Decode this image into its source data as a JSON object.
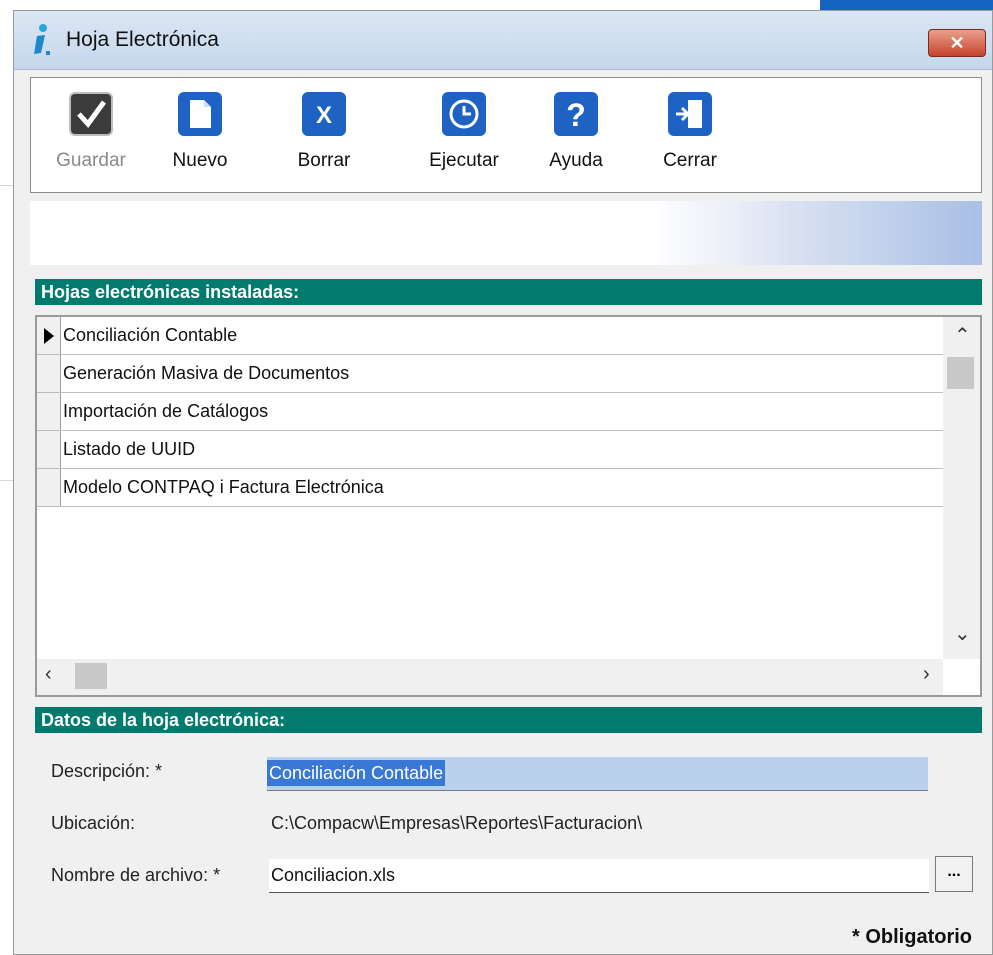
{
  "window": {
    "title": "Hoja Electrónica",
    "close_label": "✕"
  },
  "toolbar": [
    {
      "label": "Guardar",
      "icon": "checkmark-icon",
      "disabled": true
    },
    {
      "label": "Nuevo",
      "icon": "new-document-icon",
      "disabled": false
    },
    {
      "label": "Borrar",
      "icon": "delete-x-icon",
      "disabled": false
    },
    {
      "label": "Ejecutar",
      "icon": "clock-run-icon",
      "disabled": false
    },
    {
      "label": "Ayuda",
      "icon": "help-question-icon",
      "disabled": false
    },
    {
      "label": "Cerrar",
      "icon": "exit-door-icon",
      "disabled": false
    }
  ],
  "installed": {
    "header": "Hojas electrónicas instaladas:",
    "rows": [
      "Conciliación Contable",
      "Generación Masiva de Documentos",
      "Importación de Catálogos",
      "Listado de UUID",
      "Modelo CONTPAQ i Factura Electrónica"
    ],
    "selected_index": 0
  },
  "details": {
    "header": "Datos de la hoja electrónica:",
    "descripcion_label": "Descripción: *",
    "descripcion_value": "Conciliación Contable",
    "ubicacion_label": "Ubicación:",
    "ubicacion_value": "C:\\Compacw\\Empresas\\Reportes\\Facturacion\\",
    "archivo_label": "Nombre de archivo: *",
    "archivo_value": "Conciliacion.xls",
    "browse_label": "...",
    "required_note": "* Obligatorio"
  },
  "colors": {
    "section": "#007b6e",
    "icon_blue": "#1e63c4",
    "selection": "#bad1ee"
  }
}
